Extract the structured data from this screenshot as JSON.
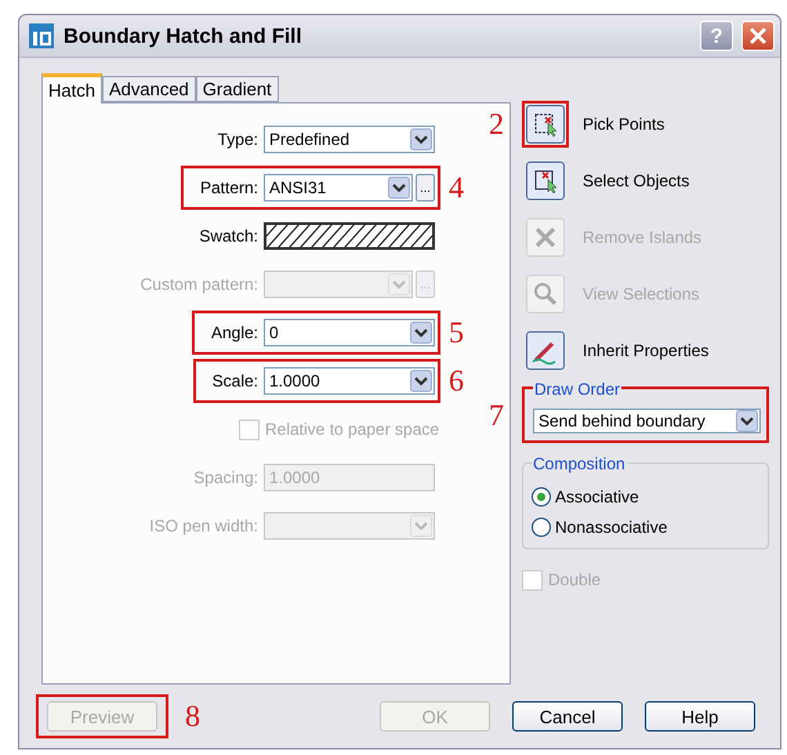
{
  "window": {
    "title": "Boundary Hatch and Fill"
  },
  "title_buttons": [
    {
      "kind": "help",
      "label": "?"
    },
    {
      "kind": "close"
    }
  ],
  "tabs": [
    {
      "label": "Hatch",
      "selected": true
    },
    {
      "label": "Advanced",
      "selected": false
    },
    {
      "label": "Gradient",
      "selected": false
    }
  ],
  "hatch_fields": [
    {
      "kind": "dropdown",
      "label": "Type:",
      "value": "Predefined",
      "disabled": false
    },
    {
      "kind": "dropdown",
      "label": "Pattern:",
      "value": "ANSI31",
      "disabled": false,
      "browse": "...",
      "callout": "4"
    },
    {
      "kind": "swatch",
      "label": "Swatch:",
      "disabled": false
    },
    {
      "kind": "dropdown",
      "label": "Custom pattern:",
      "disabled": true,
      "browse": "..."
    },
    {
      "kind": "dropdown",
      "label": "Angle:",
      "value": "0",
      "disabled": false,
      "callout": "5"
    },
    {
      "kind": "dropdown",
      "label": "Scale:",
      "value": "1.0000",
      "disabled": false,
      "callout": "6"
    },
    {
      "kind": "checkbox",
      "label": "Relative to paper space",
      "checked": false,
      "disabled": true
    },
    {
      "kind": "text",
      "label": "Spacing:",
      "value": "1.0000",
      "disabled": true
    },
    {
      "kind": "dropdown",
      "label": "ISO pen width:",
      "disabled": true
    }
  ],
  "actions": [
    {
      "kind": "pick",
      "label": "Pick Points",
      "disabled": false,
      "callout": "2"
    },
    {
      "kind": "select",
      "label": "Select Objects",
      "disabled": false
    },
    {
      "kind": "remove",
      "label": "Remove Islands",
      "disabled": true
    },
    {
      "kind": "view",
      "label": "View Selections",
      "disabled": true
    },
    {
      "kind": "inherit",
      "label": "Inherit Properties",
      "disabled": false
    }
  ],
  "draw_order": {
    "label": "Draw Order",
    "value": "Send behind boundary",
    "callout": "7"
  },
  "composition": {
    "label": "Composition",
    "options": [
      {
        "label": "Associative",
        "selected": true
      },
      {
        "label": "Nonassociative",
        "selected": false
      }
    ]
  },
  "double": {
    "label": "Double",
    "checked": false,
    "disabled": true
  },
  "footer_buttons": [
    {
      "label": "Preview",
      "disabled": true,
      "callout": "8"
    },
    {
      "label": "OK",
      "disabled": true
    },
    {
      "label": "Cancel",
      "disabled": false
    },
    {
      "label": "Help",
      "disabled": false
    }
  ]
}
